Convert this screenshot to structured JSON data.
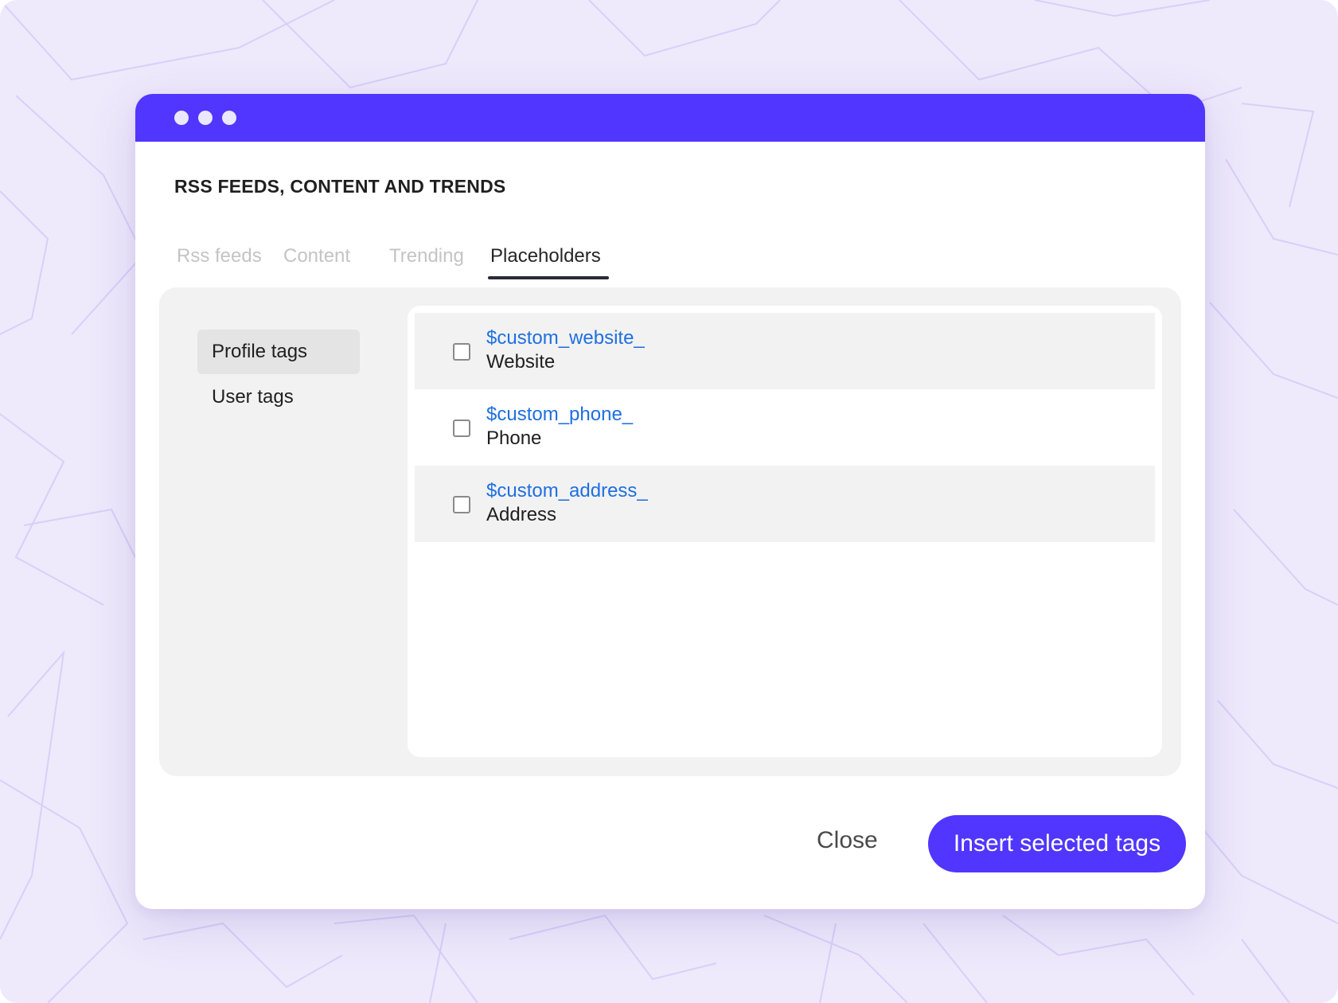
{
  "colors": {
    "background": "#efe9fc",
    "accent": "#5036ff",
    "link": "#1f6fe0",
    "panel": "#f2f2f2"
  },
  "window": {
    "controls": [
      "dot",
      "dot",
      "dot"
    ]
  },
  "dialog": {
    "title": "RSS FEEDS, CONTENT AND TRENDS",
    "tabs": [
      {
        "label": "Rss feeds",
        "active": false
      },
      {
        "label": "Content",
        "active": false
      },
      {
        "label": "Trending",
        "active": false
      },
      {
        "label": "Placeholders",
        "active": true
      }
    ],
    "sidebar": {
      "items": [
        {
          "label": "Profile tags",
          "active": true
        },
        {
          "label": "User tags",
          "active": false
        }
      ]
    },
    "tags": [
      {
        "code": "$custom_website_",
        "label": "Website",
        "checked": false
      },
      {
        "code": "$custom_phone_",
        "label": "Phone",
        "checked": false
      },
      {
        "code": "$custom_address_",
        "label": "Address",
        "checked": false
      }
    ],
    "buttons": {
      "close": "Close",
      "insert": "Insert selected tags"
    }
  }
}
